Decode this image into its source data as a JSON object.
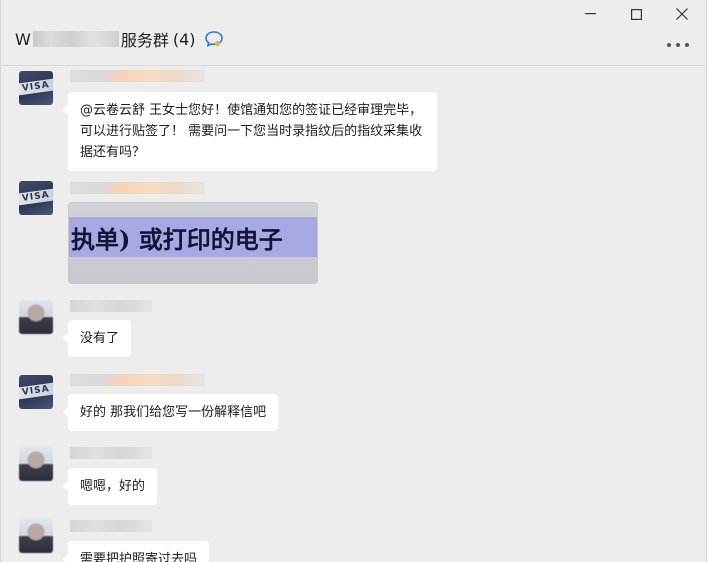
{
  "window": {
    "title_prefix": "W",
    "title_suffix": "服务群",
    "member_count": "(4)",
    "controls": [
      "minimize",
      "maximize",
      "close"
    ],
    "icons": [
      "chat-bubble-icon",
      "more-icon"
    ]
  },
  "messages": [
    {
      "sender_type": "agent",
      "type": "text",
      "text": "@云卷云舒  王女士您好！使馆通知您的签证已经审理完毕，可以进行贴签了！ 需要问一下您当时录指纹后的指纹采集收据还有吗？"
    },
    {
      "sender_type": "agent",
      "type": "image",
      "image_text": "执单) 或打印的电子"
    },
    {
      "sender_type": "customer",
      "type": "text",
      "text": "没有了"
    },
    {
      "sender_type": "agent",
      "type": "text",
      "text": "好的 那我们给您写一份解释信吧"
    },
    {
      "sender_type": "customer",
      "type": "text",
      "text": "嗯嗯，好的"
    },
    {
      "sender_type": "customer",
      "type": "text",
      "text": "需要把护照寄过去吗"
    }
  ],
  "avatar": {
    "visa_label": "VISA"
  },
  "colors": {
    "background": "#ededed",
    "bubble": "#ffffff",
    "accent": "#2a7fd4"
  }
}
